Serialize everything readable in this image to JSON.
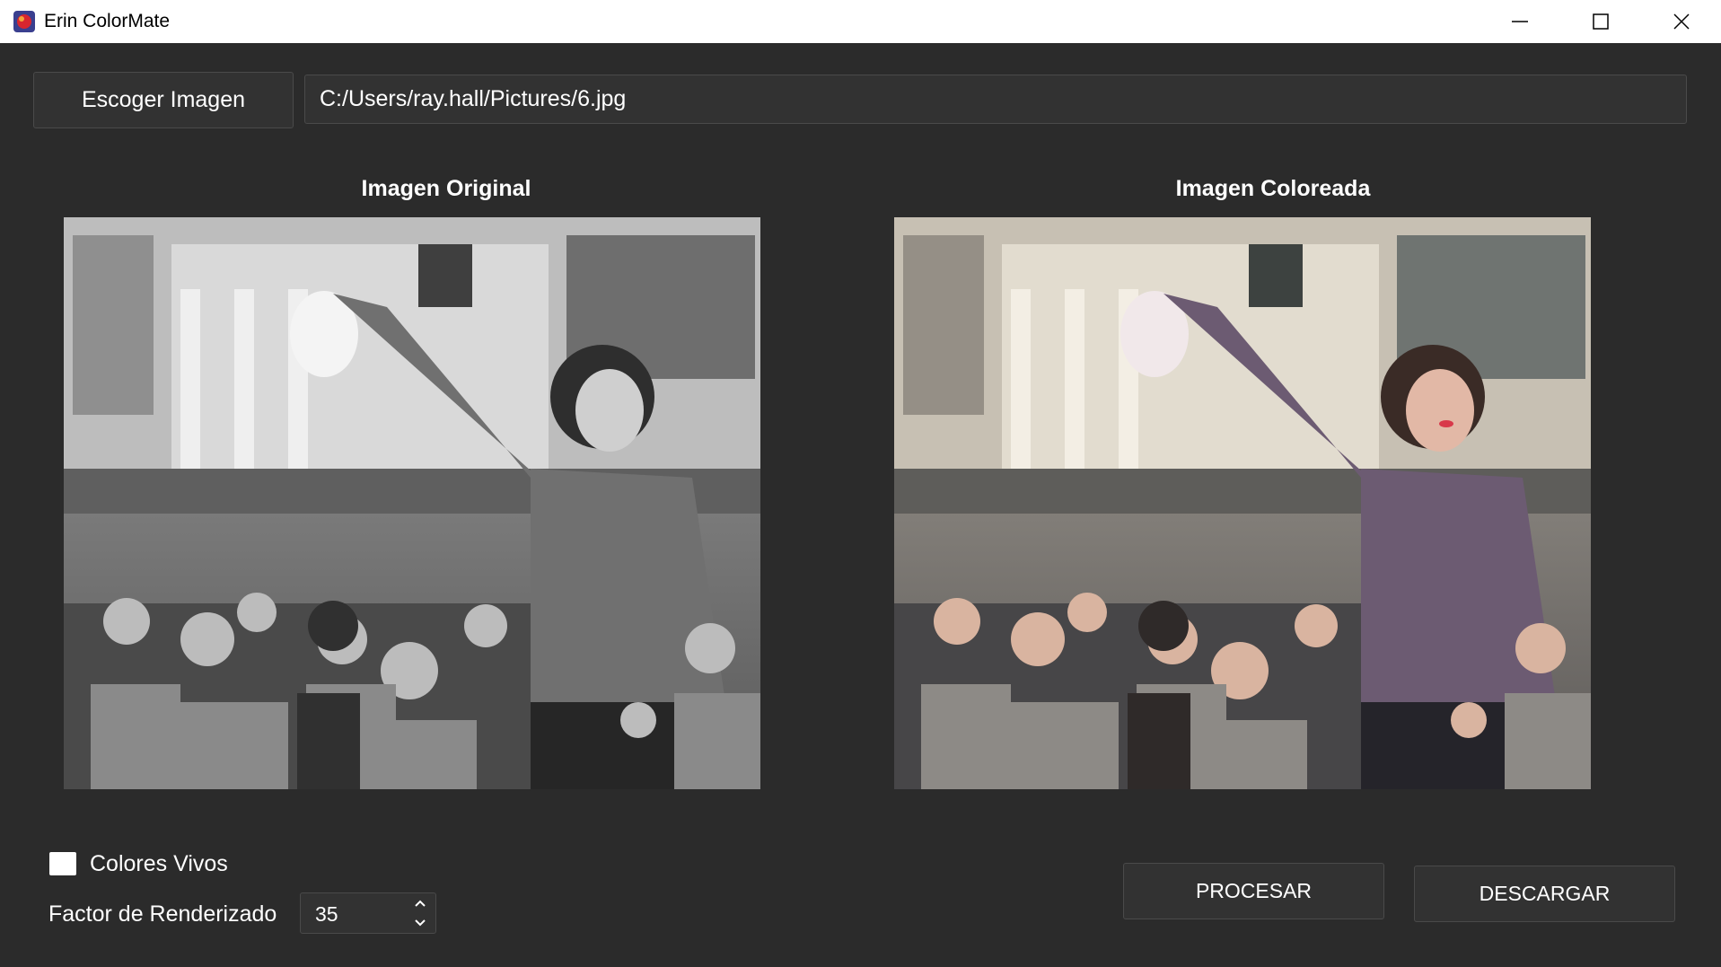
{
  "window": {
    "title": "Erin ColorMate",
    "icons": [
      "app-icon",
      "minimize-icon",
      "maximize-icon",
      "close-icon"
    ]
  },
  "toolbar": {
    "choose_label": "Escoger Imagen",
    "path_value": "C:/Users/ray.hall/Pictures/6.jpg"
  },
  "panels": {
    "original_title": "Imagen Original",
    "colored_title": "Imagen Coloreada"
  },
  "options": {
    "vivid_label": "Colores Vivos",
    "vivid_checked": false,
    "factor_label": "Factor de Renderizado",
    "factor_value": "35"
  },
  "actions": {
    "process_label": "PROCESAR",
    "download_label": "DESCARGAR"
  },
  "colors": {
    "background": "#2b2b2b",
    "control": "#323232",
    "border": "#4a4a4a",
    "text": "#ffffff"
  }
}
